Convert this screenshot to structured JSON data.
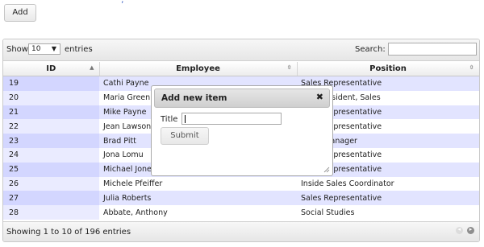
{
  "header": {
    "add_label": "Add",
    "top_link_fragment": ", "
  },
  "length_menu": {
    "prefix": "Show",
    "selected": "10",
    "suffix": "entries"
  },
  "search": {
    "label": "Search:",
    "value": ""
  },
  "table": {
    "columns": [
      {
        "label": "ID",
        "sort": "ascending"
      },
      {
        "label": "Employee",
        "sort": "both"
      },
      {
        "label": "Position",
        "sort": "both"
      }
    ],
    "rows": [
      {
        "id": "19",
        "employee": "Cathi Payne",
        "position": "Sales Representative"
      },
      {
        "id": "20",
        "employee": "Maria Green",
        "position": "Vice President, Sales"
      },
      {
        "id": "21",
        "employee": "Mike Payne",
        "position": "Sales Representative"
      },
      {
        "id": "22",
        "employee": "Jean Lawson",
        "position": "Sales Representative"
      },
      {
        "id": "23",
        "employee": "Brad Pitt",
        "position": "Sales Manager"
      },
      {
        "id": "24",
        "employee": "Jona Lomu",
        "position": "Sales Representative"
      },
      {
        "id": "25",
        "employee": "Michael Jones",
        "position": "Sales Representative"
      },
      {
        "id": "26",
        "employee": "Michele Pfeiffer",
        "position": "Inside Sales Coordinator"
      },
      {
        "id": "27",
        "employee": "Julia Roberts",
        "position": "Sales Representative"
      },
      {
        "id": "28",
        "employee": "Abbate, Anthony",
        "position": "Social Studies"
      }
    ]
  },
  "info": "Showing 1 to 10 of 196 entries",
  "pager": {
    "prev_icon": "prev-page-icon",
    "next_icon": "next-page-icon"
  },
  "dialog": {
    "title": "Add new item",
    "close_glyph": "✖",
    "field_label": "Title",
    "field_value": "",
    "submit_label": "Submit"
  }
}
